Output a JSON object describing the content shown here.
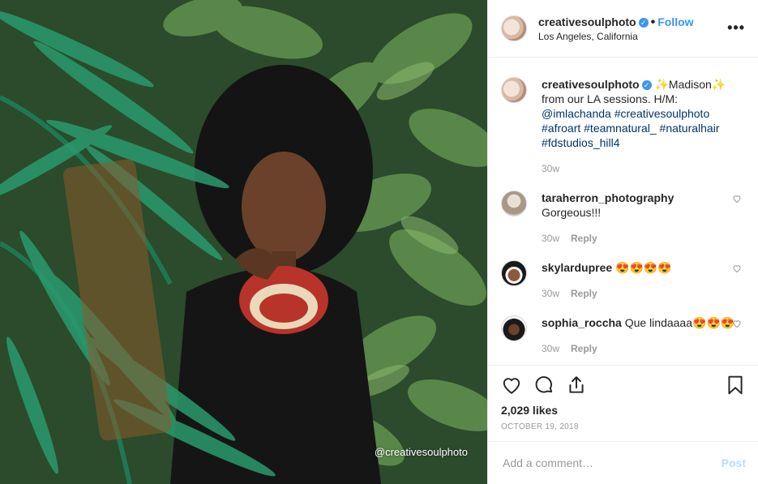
{
  "post": {
    "username": "creativesoulphoto",
    "verified_icon": "verified-badge-icon",
    "separator": "•",
    "follow_label": "Follow",
    "location": "Los Angeles, California",
    "more_icon": "more-options-icon",
    "more_label": "•••",
    "watermark": "@creativesoulphoto"
  },
  "caption": {
    "username": "creativesoulphoto",
    "text_start": " ✨Madison✨ from our LA sessions. H/M: ",
    "mention": "@imlachanda",
    "hashtags": [
      "#creativesoulphoto",
      "#afroart",
      "#teamnatural_",
      "#naturalhair",
      "#fdstudios_hill4"
    ],
    "time": "30w"
  },
  "comments": [
    {
      "username": "taraherron_photography",
      "text": "Gorgeous!!!",
      "time": "30w",
      "reply": "Reply"
    },
    {
      "username": "skylardupree",
      "text": "😍😍😍😍",
      "time": "30w",
      "reply": "Reply"
    },
    {
      "username": "sophia_roccha",
      "text": "Que lindaaaa😍😍😍",
      "time": "30w",
      "reply": "Reply"
    }
  ],
  "actions": {
    "likes": "2,029 likes",
    "date": "OCTOBER 19, 2018",
    "icons": [
      "heart-icon",
      "comment-icon",
      "share-icon",
      "bookmark-icon"
    ]
  },
  "add_comment": {
    "placeholder": "Add a comment…",
    "post_label": "Post"
  },
  "colors": {
    "accent": "#3897f0",
    "tag": "#003569",
    "muted": "#999999",
    "post_disabled": "#b2dffc"
  }
}
